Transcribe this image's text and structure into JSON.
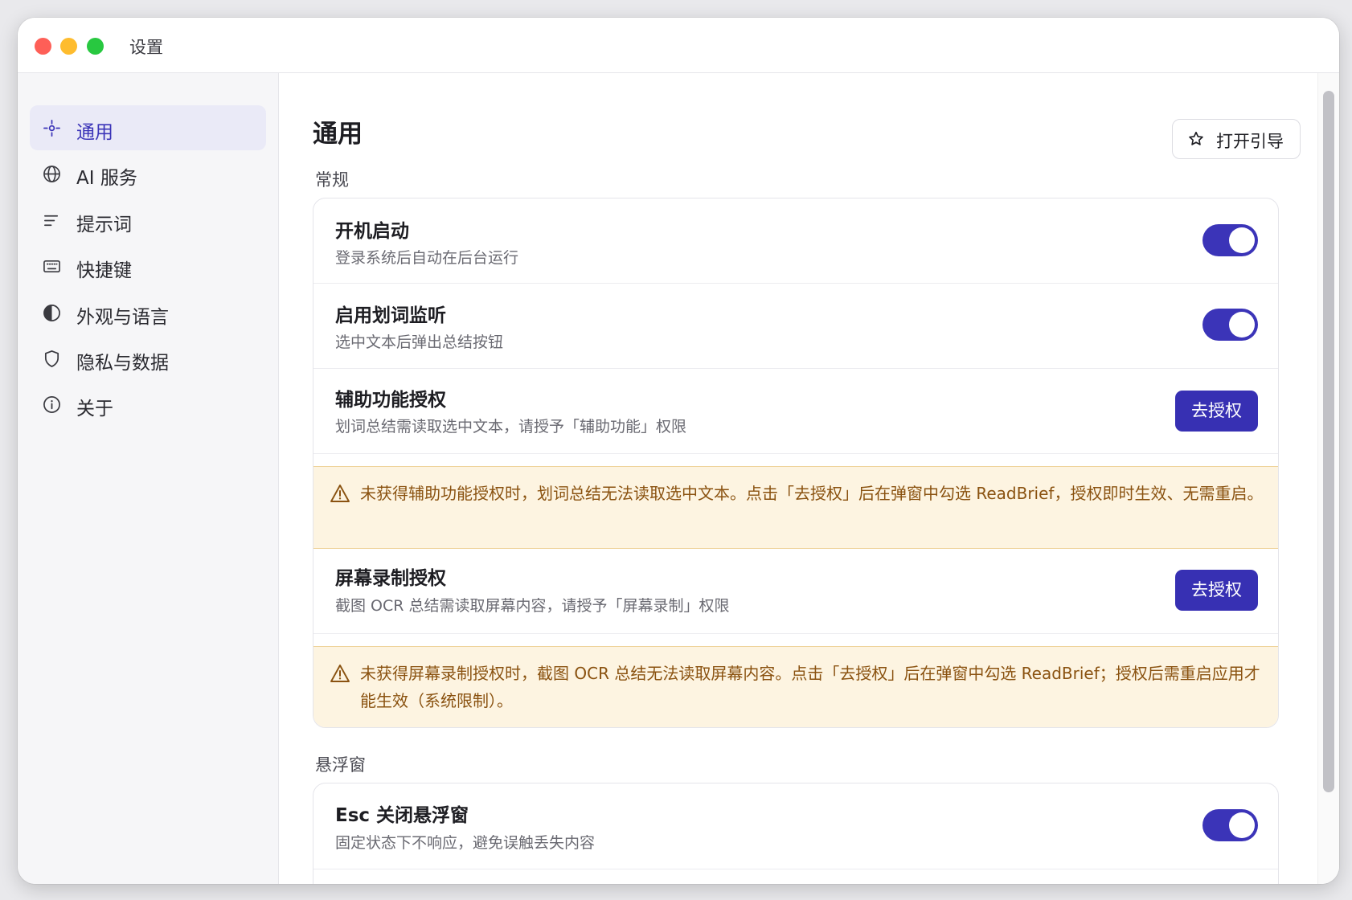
{
  "window": {
    "title": "设置"
  },
  "sidebar": {
    "items": [
      {
        "label": "通用",
        "icon": "general-icon",
        "active": true
      },
      {
        "label": "AI 服务",
        "icon": "globe-icon",
        "active": false
      },
      {
        "label": "提示词",
        "icon": "text-lines-icon",
        "active": false
      },
      {
        "label": "快捷键",
        "icon": "keyboard-icon",
        "active": false
      },
      {
        "label": "外观与语言",
        "icon": "half-circle-icon",
        "active": false
      },
      {
        "label": "隐私与数据",
        "icon": "shield-icon",
        "active": false
      },
      {
        "label": "关于",
        "icon": "info-icon",
        "active": false
      }
    ]
  },
  "main": {
    "title": "通用",
    "guide_button": {
      "label": "打开引导",
      "icon": "star-icon"
    },
    "sections": {
      "general": {
        "label": "常规",
        "rows": {
          "startup": {
            "title": "开机启动",
            "desc": "登录系统后自动在后台运行",
            "toggle_on": true
          },
          "selection_listen": {
            "title": "启用划词监听",
            "desc": "选中文本后弹出总结按钮",
            "toggle_on": true
          },
          "accessibility": {
            "title": "辅助功能授权",
            "desc": "划词总结需读取选中文本，请授予「辅助功能」权限",
            "button": "去授权",
            "warning": "未获得辅助功能授权时，划词总结无法读取选中文本。点击「去授权」后在弹窗中勾选 ReadBrief，授权即时生效、无需重启。"
          },
          "screen_record": {
            "title": "屏幕录制授权",
            "desc": "截图 OCR 总结需读取屏幕内容，请授予「屏幕录制」权限",
            "button": "去授权",
            "warning": "未获得屏幕录制授权时，截图 OCR 总结无法读取屏幕内容。点击「去授权」后在弹窗中勾选 ReadBrief；授权后需重启应用才能生效（系统限制）。"
          }
        }
      },
      "floating": {
        "label": "悬浮窗",
        "rows": {
          "esc_close": {
            "title": "Esc 关闭悬浮窗",
            "desc": "固定状态下不响应，避免误触丢失内容",
            "toggle_on": true
          }
        }
      }
    }
  },
  "colors": {
    "accent": "#3b34b8",
    "warning_bg": "#fdf4e1",
    "warning_text": "#8a5210"
  }
}
